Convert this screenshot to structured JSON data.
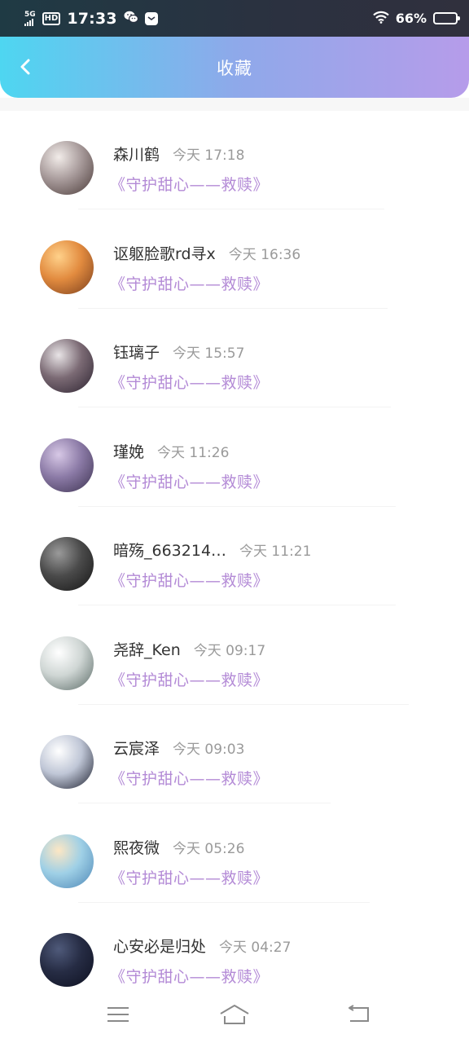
{
  "status_bar": {
    "network": "5G",
    "hd": "HD",
    "time": "17:33",
    "battery_percent": "66%",
    "battery_level": 0.66,
    "icons": [
      "signal-icon",
      "hd-icon",
      "wechat-icon",
      "notification-icon",
      "wifi-icon",
      "battery-icon"
    ]
  },
  "header": {
    "title": "收藏",
    "back_icon": "chevron-left-icon"
  },
  "colors": {
    "header_gradient": [
      "#4ed6f1",
      "#8ea9ea",
      "#b69cea"
    ],
    "accent_text": "#b38ad6",
    "name_text": "#333333",
    "time_text": "#9a9a9a"
  },
  "items": [
    {
      "name": "森川鹤",
      "time": "今天 17:18",
      "title": "《守护甜心——救赎》",
      "avatar": [
        "#f2ece9",
        "#a79a9a",
        "#4a3a38"
      ]
    },
    {
      "name": "讴躯脸歌rd寻x",
      "time": "今天 16:36",
      "title": "《守护甜心——救赎》",
      "avatar": [
        "#ffd18a",
        "#e28b3f",
        "#7a3e1c"
      ]
    },
    {
      "name": "钰璃子",
      "time": "今天 15:57",
      "title": "《守护甜心——救赎》",
      "avatar": [
        "#e8e4e6",
        "#7b6a74",
        "#2c2330"
      ]
    },
    {
      "name": "瑾娩",
      "time": "今天 11:26",
      "title": "《守护甜心——救赎》",
      "avatar": [
        "#d7c8e6",
        "#8b7aa6",
        "#3c3250"
      ]
    },
    {
      "name": "暗殇_663214…",
      "time": "今天 11:21",
      "title": "《守护甜心——救赎》",
      "avatar": [
        "#9a9a9a",
        "#4a4a4a",
        "#151515"
      ]
    },
    {
      "name": "尧辞_Ken",
      "time": "今天 09:17",
      "title": "《守护甜心——救赎》",
      "avatar": [
        "#ffffff",
        "#cfd6d4",
        "#5a6a66"
      ]
    },
    {
      "name": "云宸泽",
      "time": "今天 09:03",
      "title": "《守护甜心——救赎》",
      "avatar": [
        "#ffffff",
        "#bfc6d6",
        "#1c1f2e"
      ]
    },
    {
      "name": "熙夜微",
      "time": "今天 05:26",
      "title": "《守护甜心——救赎》",
      "avatar": [
        "#fde7c4",
        "#9fd0e6",
        "#4d86b6"
      ]
    },
    {
      "name": "心安必是归处",
      "time": "今天 04:27",
      "title": "《守护甜心——救赎》",
      "avatar": [
        "#4f5a7a",
        "#262c44",
        "#0d1020"
      ]
    }
  ],
  "nav": {
    "icons": [
      "menu-icon",
      "home-icon",
      "back-icon"
    ]
  }
}
